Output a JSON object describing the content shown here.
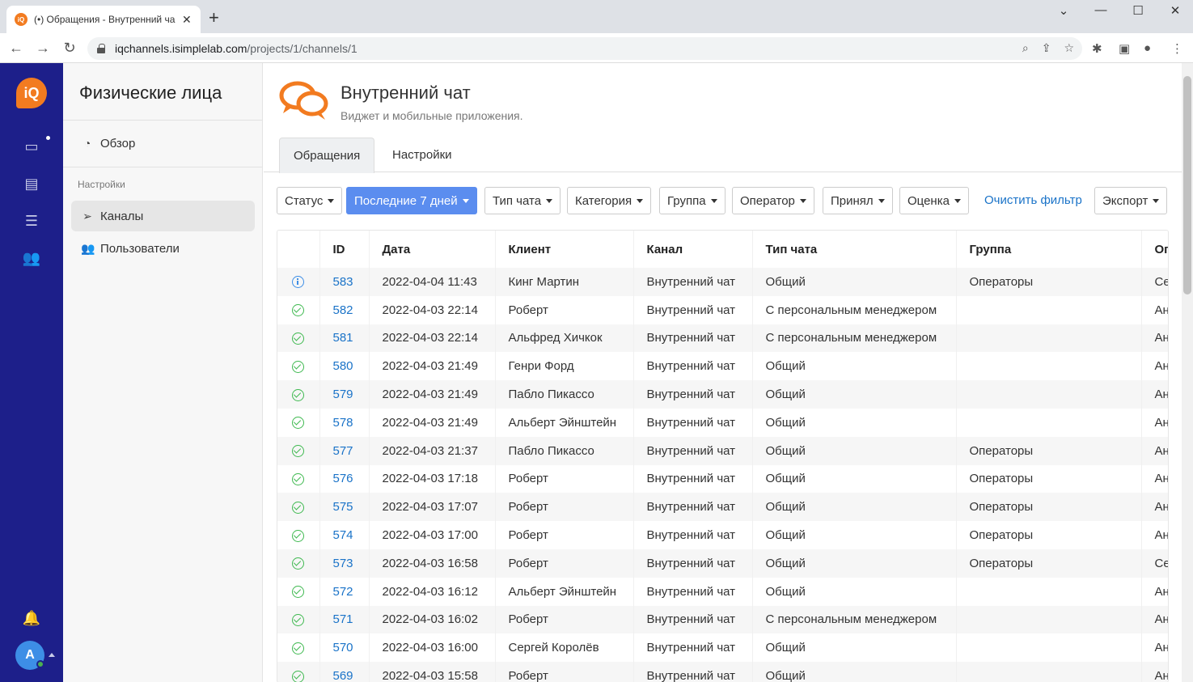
{
  "browser": {
    "tab_title": "(•) Обращения - Внутренний ча",
    "new_tab": "+",
    "url_host": "iqchannels.isimplelab.com",
    "url_path": "/projects/1/channels/1"
  },
  "rail": {
    "logo_text": "iQ",
    "avatar_letter": "A"
  },
  "sidebar": {
    "title": "Физические лица",
    "overview_label": "Обзор",
    "section_label": "Настройки",
    "channels_label": "Каналы",
    "users_label": "Пользователи"
  },
  "page": {
    "title": "Внутренний чат",
    "subtitle": "Виджет и мобильные приложения.",
    "tabs": [
      "Обращения",
      "Настройки"
    ]
  },
  "filters": {
    "status": "Статус",
    "period": "Последние 7 дней",
    "chat_type": "Тип чата",
    "category": "Категория",
    "group": "Группа",
    "operator": "Оператор",
    "accepted": "Принял",
    "rating": "Оценка",
    "clear": "Очистить фильтр",
    "export": "Экспорт"
  },
  "table": {
    "columns": [
      "ID",
      "Дата",
      "Клиент",
      "Канал",
      "Тип чата",
      "Группа",
      "Оп"
    ],
    "rows": [
      {
        "status": "open",
        "id": "583",
        "date": "2022-04-04 11:43",
        "client": "Кинг Мартин",
        "channel": "Внутренний чат",
        "type": "Общий",
        "group": "Операторы",
        "op": "Се"
      },
      {
        "status": "done",
        "id": "582",
        "date": "2022-04-03 22:14",
        "client": "Роберт",
        "channel": "Внутренний чат",
        "type": "С персональным менеджером",
        "group": "",
        "op": "Ан"
      },
      {
        "status": "done",
        "id": "581",
        "date": "2022-04-03 22:14",
        "client": "Альфред Хичкок",
        "channel": "Внутренний чат",
        "type": "С персональным менеджером",
        "group": "",
        "op": "Ан"
      },
      {
        "status": "done",
        "id": "580",
        "date": "2022-04-03 21:49",
        "client": "Генри Форд",
        "channel": "Внутренний чат",
        "type": "Общий",
        "group": "",
        "op": "Ан"
      },
      {
        "status": "done",
        "id": "579",
        "date": "2022-04-03 21:49",
        "client": "Пабло Пикассо",
        "channel": "Внутренний чат",
        "type": "Общий",
        "group": "",
        "op": "Ан"
      },
      {
        "status": "done",
        "id": "578",
        "date": "2022-04-03 21:49",
        "client": "Альберт Эйнштейн",
        "channel": "Внутренний чат",
        "type": "Общий",
        "group": "",
        "op": "Ан"
      },
      {
        "status": "done",
        "id": "577",
        "date": "2022-04-03 21:37",
        "client": "Пабло Пикассо",
        "channel": "Внутренний чат",
        "type": "Общий",
        "group": "Операторы",
        "op": "Ан"
      },
      {
        "status": "done",
        "id": "576",
        "date": "2022-04-03 17:18",
        "client": "Роберт",
        "channel": "Внутренний чат",
        "type": "Общий",
        "group": "Операторы",
        "op": "Ан"
      },
      {
        "status": "done",
        "id": "575",
        "date": "2022-04-03 17:07",
        "client": "Роберт",
        "channel": "Внутренний чат",
        "type": "Общий",
        "group": "Операторы",
        "op": "Ан"
      },
      {
        "status": "done",
        "id": "574",
        "date": "2022-04-03 17:00",
        "client": "Роберт",
        "channel": "Внутренний чат",
        "type": "Общий",
        "group": "Операторы",
        "op": "Ан"
      },
      {
        "status": "done",
        "id": "573",
        "date": "2022-04-03 16:58",
        "client": "Роберт",
        "channel": "Внутренний чат",
        "type": "Общий",
        "group": "Операторы",
        "op": "Се"
      },
      {
        "status": "done",
        "id": "572",
        "date": "2022-04-03 16:12",
        "client": "Альберт Эйнштейн",
        "channel": "Внутренний чат",
        "type": "Общий",
        "group": "",
        "op": "Ан"
      },
      {
        "status": "done",
        "id": "571",
        "date": "2022-04-03 16:02",
        "client": "Роберт",
        "channel": "Внутренний чат",
        "type": "С персональным менеджером",
        "group": "",
        "op": "Ан"
      },
      {
        "status": "done",
        "id": "570",
        "date": "2022-04-03 16:00",
        "client": "Сергей Королёв",
        "channel": "Внутренний чат",
        "type": "Общий",
        "group": "",
        "op": "Ан"
      },
      {
        "status": "done",
        "id": "569",
        "date": "2022-04-03 15:58",
        "client": "Роберт",
        "channel": "Внутренний чат",
        "type": "Общий",
        "group": "",
        "op": "Ан"
      }
    ]
  },
  "colors": {
    "rail": "#1d1f8a",
    "brand_orange": "#f27b20",
    "primary_button": "#5b8def",
    "link": "#1a73c8",
    "status_done": "#3fb950",
    "status_open": "#3d8ee6"
  }
}
